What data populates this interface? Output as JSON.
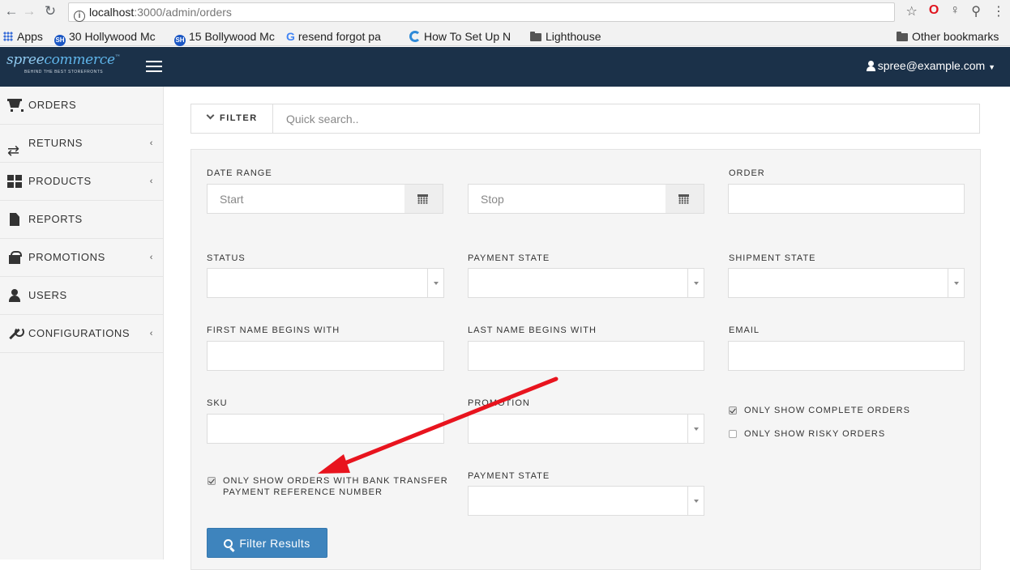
{
  "browser": {
    "address_host": "localhost",
    "address_path": ":3000/admin/orders",
    "bookmarks": [
      {
        "label": "Apps",
        "icon": "apps-grid-icon"
      },
      {
        "label": "30 Hollywood Mc",
        "icon": "site-dot-icon"
      },
      {
        "label": "15 Bollywood Mc",
        "icon": "site-dot-icon"
      },
      {
        "label": "resend forgot pa",
        "icon": "google-icon"
      },
      {
        "label": "How To Set Up N",
        "icon": "arc-icon"
      },
      {
        "label": "Lighthouse",
        "icon": "folder-icon"
      }
    ],
    "other_bookmarks": "Other bookmarks"
  },
  "header": {
    "logo_main": "spree",
    "logo_accent": "commerce",
    "logo_tagline": "BEHIND THE BEST STOREFRONTS",
    "user_email": "spree@example.com"
  },
  "sidebar": {
    "items": [
      {
        "label": "ORDERS",
        "icon": "cart-icon",
        "has_submenu": false
      },
      {
        "label": "RETURNS",
        "icon": "swap-icon",
        "has_submenu": true
      },
      {
        "label": "PRODUCTS",
        "icon": "grid-icon",
        "has_submenu": true
      },
      {
        "label": "REPORTS",
        "icon": "file-icon",
        "has_submenu": false
      },
      {
        "label": "PROMOTIONS",
        "icon": "gift-icon",
        "has_submenu": true
      },
      {
        "label": "USERS",
        "icon": "user-icon",
        "has_submenu": false
      },
      {
        "label": "CONFIGURATIONS",
        "icon": "wrench-icon",
        "has_submenu": true
      }
    ],
    "chevron": "‹"
  },
  "search": {
    "filter_label": "FILTER",
    "placeholder": "Quick search.."
  },
  "filters": {
    "date_range_label": "DATE RANGE",
    "start_placeholder": "Start",
    "stop_placeholder": "Stop",
    "order_label": "ORDER",
    "status_label": "STATUS",
    "payment_state_label": "PAYMENT STATE",
    "shipment_state_label": "SHIPMENT STATE",
    "first_name_label": "FIRST NAME BEGINS WITH",
    "last_name_label": "LAST NAME BEGINS WITH",
    "email_label": "EMAIL",
    "sku_label": "SKU",
    "promotion_label": "PROMOTION",
    "only_complete_label": "ONLY SHOW COMPLETE ORDERS",
    "only_complete_checked": true,
    "only_risky_label": "ONLY SHOW RISKY ORDERS",
    "only_risky_checked": false,
    "bank_transfer_label_line1": "ONLY SHOW ORDERS WITH BANK TRANSFER",
    "bank_transfer_label_line2": "PAYMENT REFERENCE NUMBER",
    "bank_transfer_checked": true,
    "payment_state_2_label": "PAYMENT STATE",
    "filter_button_label": "Filter Results"
  },
  "colors": {
    "header_bg": "#1b3149",
    "primary_button": "#3e84bd",
    "annotation_arrow": "#e8141e"
  }
}
